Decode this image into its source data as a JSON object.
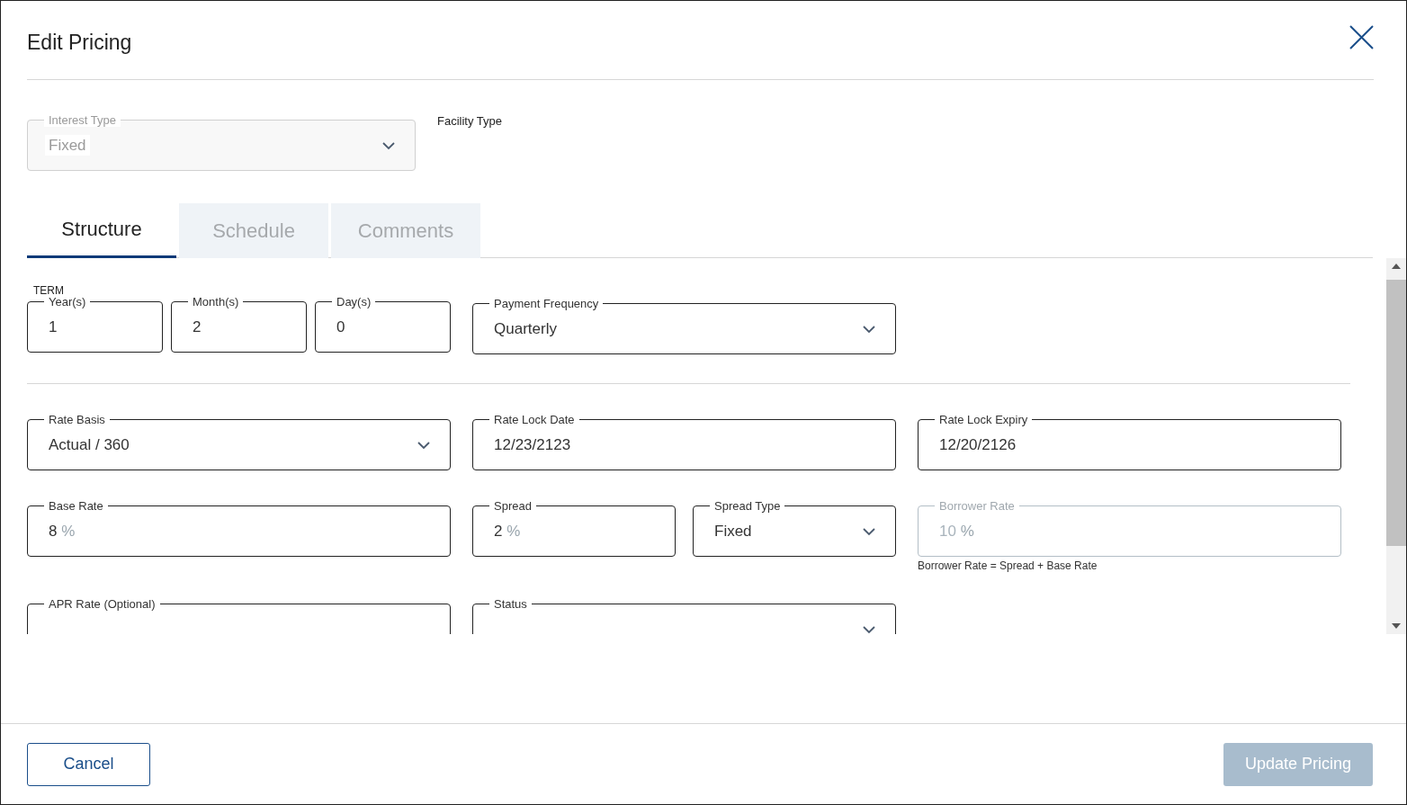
{
  "dialog": {
    "title": "Edit Pricing"
  },
  "interest_type": {
    "kind": "select",
    "label": "Interest Type",
    "value": "Fixed",
    "disabled": true
  },
  "facility_type": {
    "label": "Facility Type"
  },
  "tabs": [
    {
      "label": "Structure",
      "selected": true
    },
    {
      "label": "Schedule",
      "selected": false
    },
    {
      "label": "Comments",
      "selected": false
    }
  ],
  "sections": [
    {
      "rows": [
        [
          {
            "heading": "TERM",
            "fields": [
              {
                "kind": "text",
                "label": "Year(s)",
                "value": "1",
                "disabled": false
              },
              {
                "kind": "text",
                "label": "Month(s)",
                "value": "2",
                "disabled": false
              },
              {
                "kind": "text",
                "label": "Day(s)",
                "value": "0",
                "disabled": false
              }
            ]
          },
          {
            "fields": [
              {
                "kind": "select",
                "label": "Payment Frequency",
                "value": "Quarterly",
                "disabled": false
              }
            ]
          }
        ]
      ]
    },
    {
      "rows": [
        [
          {
            "fields": [
              {
                "kind": "select",
                "label": "Rate Basis",
                "value": "Actual / 360",
                "disabled": false
              }
            ]
          },
          {
            "fields": [
              {
                "kind": "text",
                "label": "Rate Lock Date",
                "value": "12/23/2123",
                "disabled": false
              }
            ]
          },
          {
            "fields": [
              {
                "kind": "text",
                "label": "Rate Lock Expiry",
                "value": "12/20/2126",
                "disabled": false
              }
            ]
          }
        ],
        [
          {
            "fields": [
              {
                "kind": "percent",
                "label": "Base Rate",
                "value": "8",
                "suffix": "%",
                "disabled": false
              }
            ]
          },
          {
            "fields": [
              {
                "kind": "percent",
                "label": "Spread",
                "value": "2",
                "suffix": "%",
                "disabled": false
              },
              {
                "kind": "select",
                "label": "Spread Type",
                "value": "Fixed",
                "disabled": false
              }
            ]
          },
          {
            "fields": [
              {
                "kind": "percent",
                "label": "Borrower Rate",
                "value": "10",
                "suffix": "%",
                "disabled": true
              }
            ],
            "helper": "Borrower Rate = Spread + Base Rate"
          }
        ],
        [
          {
            "fields": [
              {
                "kind": "text",
                "label": "APR Rate (Optional)",
                "disabled": false
              }
            ]
          },
          {
            "fields": [
              {
                "kind": "select",
                "label": "Status",
                "disabled": false
              }
            ]
          }
        ]
      ]
    }
  ],
  "buttons": [
    {
      "kind": "secondary",
      "label": "Cancel",
      "disabled": false
    },
    {
      "kind": "primary",
      "label": "Update Pricing",
      "disabled": true
    }
  ]
}
